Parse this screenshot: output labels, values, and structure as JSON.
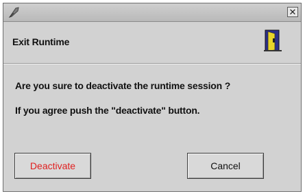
{
  "window": {
    "title": ""
  },
  "dialog": {
    "header_title": "Exit Runtime",
    "message_line1": "Are you sure to deactivate the runtime session ?",
    "message_line2": "If you agree push the \"deactivate\" button."
  },
  "buttons": {
    "deactivate_label": "Deactivate",
    "cancel_label": "Cancel"
  },
  "icons": {
    "titlebar": "app-feather-icon",
    "close": "close-icon",
    "header": "exit-door-icon"
  },
  "colors": {
    "deactivate_text": "#e02020",
    "dialog_background": "#d2d2d2"
  }
}
